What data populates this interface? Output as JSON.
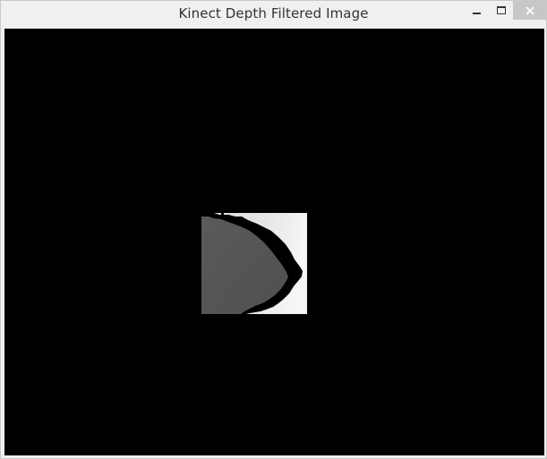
{
  "window": {
    "title": "Kinect Depth Filtered Image",
    "controls": {
      "minimize_icon": "minimize-icon",
      "maximize_icon": "maximize-icon",
      "close_icon": "close-icon"
    }
  },
  "colors": {
    "titlebar": "#f0f0f0",
    "canvas": "#000000",
    "close_button": "#c7c7c7"
  }
}
